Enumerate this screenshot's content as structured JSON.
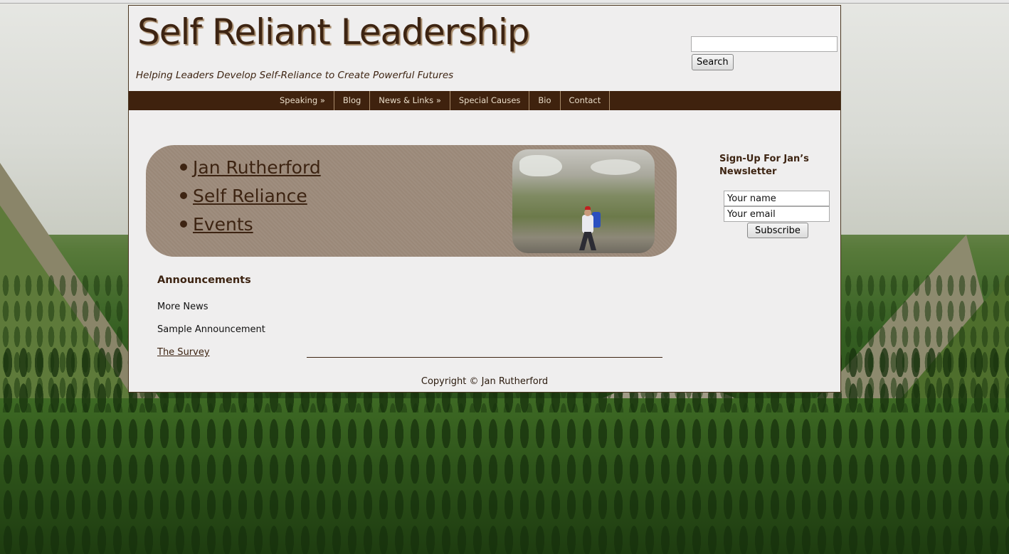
{
  "header": {
    "site_title": "Self Reliant Leadership",
    "tagline": "Helping Leaders Develop Self-Reliance to Create Powerful Futures"
  },
  "search": {
    "value": "",
    "button_label": "Search"
  },
  "nav": {
    "items": [
      {
        "label": "Speaking »"
      },
      {
        "label": "Blog"
      },
      {
        "label": "News & Links »"
      },
      {
        "label": "Special Causes"
      },
      {
        "label": "Bio"
      },
      {
        "label": "Contact"
      }
    ]
  },
  "feature": {
    "links": [
      {
        "label": "Jan Rutherford"
      },
      {
        "label": "Self Reliance"
      },
      {
        "label": "Events"
      }
    ],
    "photo_icon": "hiker-photo"
  },
  "announcements": {
    "title": "Announcements",
    "items": [
      {
        "label": "More News"
      },
      {
        "label": "Sample Announcement"
      },
      {
        "label": "The Survey"
      }
    ]
  },
  "newsletter": {
    "title": "Sign-Up For Jan’s Newsletter",
    "name_value": "Your name",
    "email_value": "Your email",
    "button_label": "Subscribe"
  },
  "footer": {
    "copyright": "Copyright © Jan Rutherford"
  },
  "colors": {
    "brand_brown": "#3f220e",
    "page_bg": "#efeeee",
    "feature_bg": "#9a8878"
  }
}
